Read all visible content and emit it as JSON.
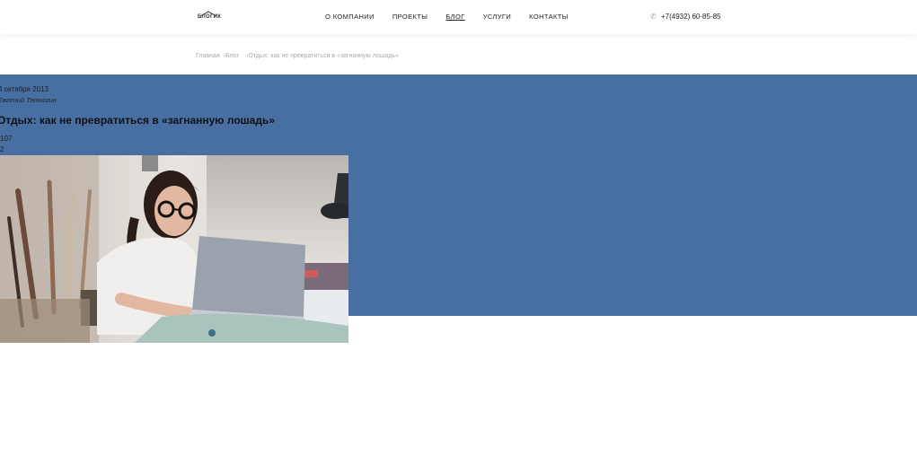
{
  "header": {
    "logo_text": "БЛОГИК",
    "nav": [
      {
        "label": "О компании",
        "active": false
      },
      {
        "label": "Проекты",
        "active": false
      },
      {
        "label": "Блог",
        "active": true
      },
      {
        "label": "Услуги",
        "active": false
      },
      {
        "label": "Контакты",
        "active": false
      }
    ],
    "phone": "+7(4932) 60-85-85"
  },
  "breadcrumbs": {
    "home": "Главная",
    "blog": "Блог",
    "current": "Отдых: как не превратиться в «загнанную лошадь»",
    "separator": "›"
  },
  "article": {
    "date": "4 октября 2013",
    "author": "Евгений Телюскин",
    "title": "Отдых: как не превратиться в «загнанную лошадь»",
    "views": "107",
    "comments": "2",
    "image_icon": "photo-woman-laptop"
  },
  "colors": {
    "panel": "#476fa2",
    "text": "#222222",
    "muted": "#aaaaaa"
  }
}
